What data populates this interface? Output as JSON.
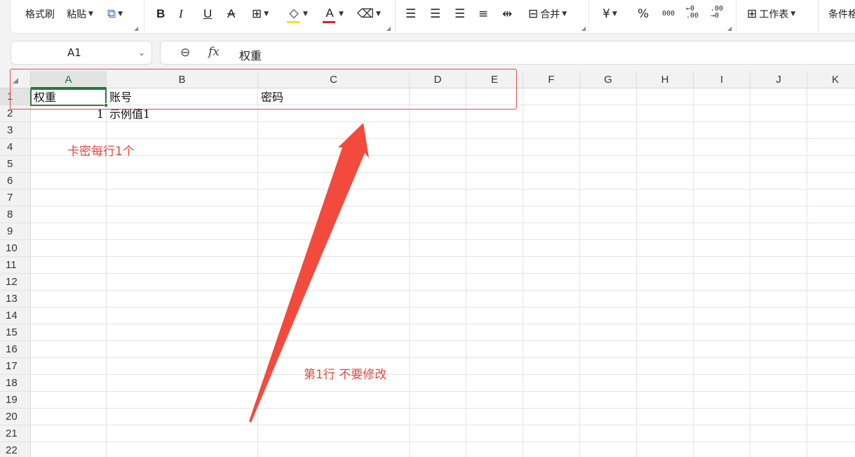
{
  "toolbar": {
    "format_painter": "格式刷",
    "paste": "粘贴",
    "bold": "B",
    "italic": "I",
    "underline": "U",
    "strikethrough": "A",
    "font_color_letter": "A",
    "merge": "合并",
    "currency": "¥",
    "percent": "%",
    "thousands": "000",
    "dec_left": "←0",
    "dec_left_2": ".00",
    "dec_right": ".00",
    "dec_right_2": "→0",
    "worksheet": "工作表",
    "conditional": "条件格",
    "highlight_color": "#f5e12a",
    "font_color": "#e02020"
  },
  "formula_bar": {
    "cell_ref": "A1",
    "fx": "fx",
    "content": "权重"
  },
  "grid": {
    "columns": [
      "A",
      "B",
      "C",
      "D",
      "E",
      "F",
      "G",
      "H",
      "I",
      "J",
      "K"
    ],
    "active_column": "A",
    "active_row": "1",
    "rows": [
      "1",
      "2",
      "3",
      "4",
      "5",
      "6",
      "7",
      "8",
      "9",
      "10",
      "11",
      "12",
      "13",
      "14",
      "15",
      "16",
      "17",
      "18",
      "19",
      "20",
      "21",
      "22"
    ],
    "cells": {
      "A1": "权重",
      "B1": "账号",
      "C1": "密码",
      "A2": "1",
      "B2": "示例值1"
    }
  },
  "annotations": {
    "note_one_per_line": "卡密每行1个",
    "note_row_one": "第1行 不要修改",
    "color": "#e8473a"
  }
}
